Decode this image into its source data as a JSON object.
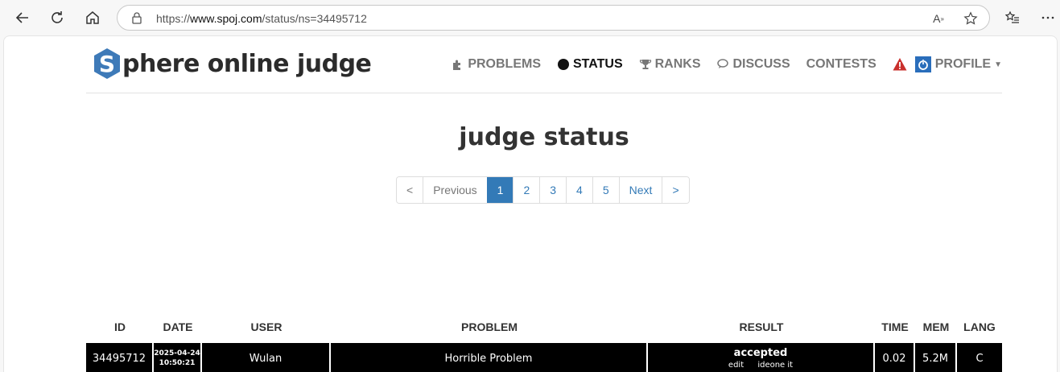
{
  "browser": {
    "url_prefix": "https://",
    "url_host": "www.spoj.com",
    "url_path": "/status/ns=34495712"
  },
  "site": {
    "logo_letter": "S",
    "logo_text": "phere online judge",
    "logo_color": "#3e7ab8"
  },
  "menu": {
    "problems": "PROBLEMS",
    "status": "STATUS",
    "ranks": "RANKS",
    "discuss": "DISCUSS",
    "contests": "CONTESTS",
    "profile": "PROFILE"
  },
  "page": {
    "title": "judge status"
  },
  "pagination": {
    "first": "<",
    "previous": "Previous",
    "pages": [
      "1",
      "2",
      "3",
      "4",
      "5"
    ],
    "active_page": "1",
    "next": "Next",
    "last": ">"
  },
  "table": {
    "headers": {
      "id": "ID",
      "date": "DATE",
      "user": "USER",
      "problem": "PROBLEM",
      "result": "RESULT",
      "time": "TIME",
      "mem": "MEM",
      "lang": "LANG"
    },
    "rows": [
      {
        "id": "34495712",
        "date": "2025-04-24",
        "time_of_day": "10:50:21",
        "user": "Wulan",
        "problem": "Horrible Problem",
        "result": "accepted",
        "edit": "edit",
        "ideone": "ideone it",
        "time": "0.02",
        "mem": "5.2M",
        "lang": "C"
      }
    ]
  },
  "colors": {
    "accent": "#337ab7",
    "alert": "#c9302c",
    "profile_icon": "#2a6ebb"
  }
}
